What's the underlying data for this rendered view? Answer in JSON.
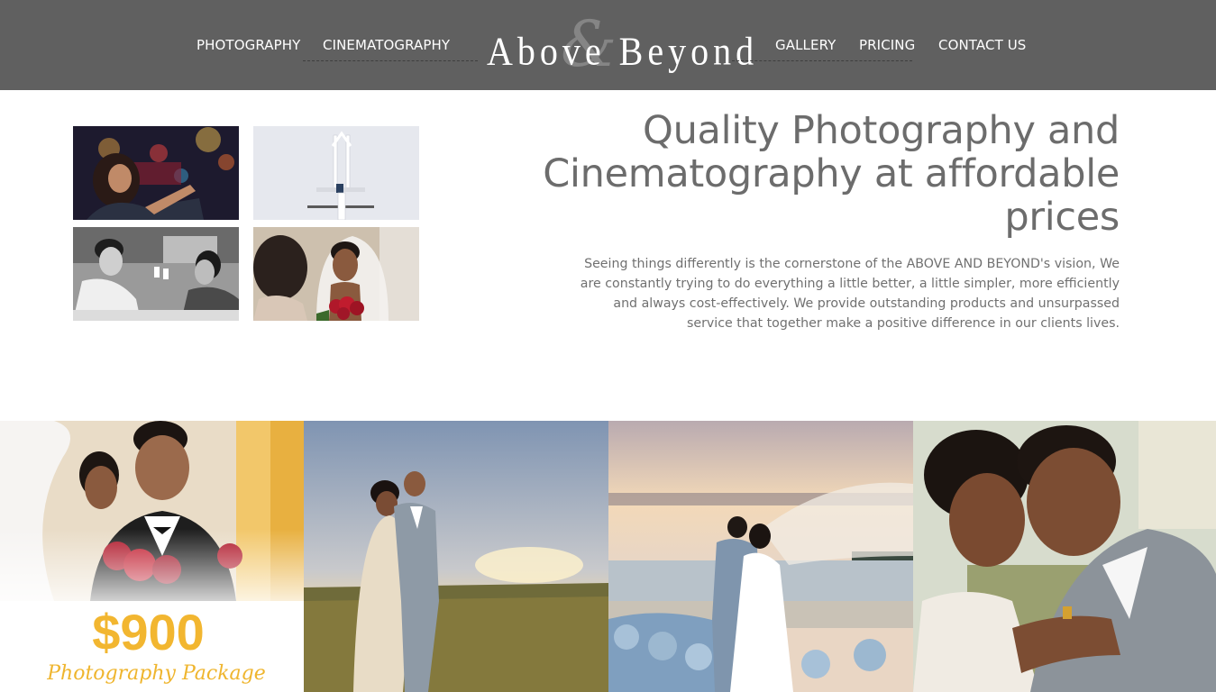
{
  "nav": {
    "left_links": [
      "PHOTOGRAPHY",
      "CINEMATOGRAPHY"
    ],
    "right_links": [
      "GALLERY",
      "PRICING",
      "CONTACT US"
    ],
    "logo_text": "Above Beyond",
    "logo_ampersand": "&"
  },
  "hero": {
    "headline": "Quality Photography and Cinematography at affordable prices",
    "intro": "Seeing things differently is the cornerstone of the ABOVE AND BEYOND's vision, We are constantly trying to do everything a little better, a little simpler, more efficiently and always cost-effectively. We provide outstanding products and unsurpassed service that together make a positive difference in our clients lives."
  },
  "promo": {
    "price": "$900",
    "package": "Photography Package"
  },
  "colors": {
    "header_bg": "#606060",
    "text_gray": "#6c6c6c",
    "gold": "#f2b630"
  }
}
